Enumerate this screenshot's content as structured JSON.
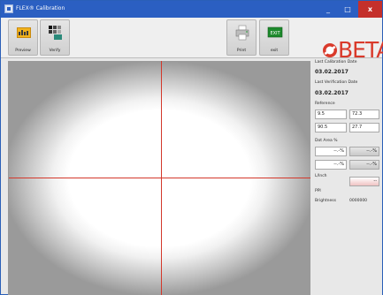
{
  "window": {
    "title": "FLEX® Calibration",
    "minimize": "_",
    "maximize": "□",
    "close": "x"
  },
  "toolbar": {
    "preview_label": "Preview",
    "verify_label": "Verify",
    "print_label": "Print",
    "exit_label": "exit",
    "exit_icon_text": "EXIT"
  },
  "logo": {
    "text": "BETA"
  },
  "panel": {
    "last_calibration_label": "Last Calibration Date",
    "last_calibration_date": "03.02.2017",
    "last_verification_label": "Last Verification Date",
    "last_verification_date": "03.02.2017",
    "reference_label": "Reference",
    "reference_values": [
      "9.5",
      "72.3",
      "90.5",
      "27.7"
    ],
    "dot_area_label": "Dot Area %",
    "dot_area_values": [
      "--.-%",
      "--.-%",
      "--.-%",
      "--.-%"
    ],
    "lpi_label": "L/Inch",
    "lpi_value": "--",
    "ppi_label": "PPI",
    "brightness_label": "Brightness",
    "brightness_value": "0000000"
  },
  "colors": {
    "titlebar": "#2b5fc2",
    "crosshair": "#d3382b",
    "logo": "#d93a2b",
    "close": "#c4302b"
  }
}
